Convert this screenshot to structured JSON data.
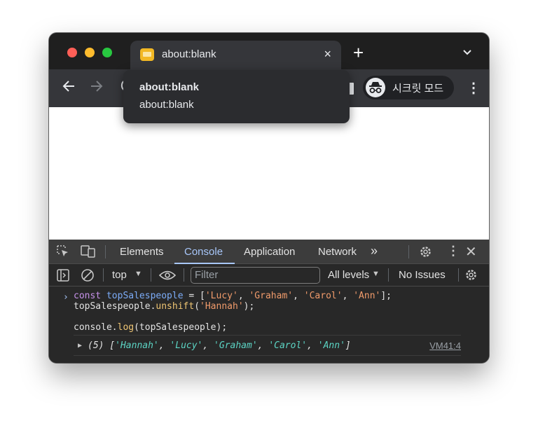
{
  "window": {
    "tab": {
      "title": "about:blank",
      "close": "×"
    },
    "new_tab": "+",
    "tab_search": "⌄",
    "incognito_label": "시크릿 모드",
    "menu": "⋮",
    "tooltip": {
      "title": "about:blank",
      "url": "about:blank"
    }
  },
  "devtools": {
    "tabs": [
      "Elements",
      "Console",
      "Application",
      "Network"
    ],
    "active_tab": "Console",
    "more_tabs": "»",
    "context": "top",
    "filter_placeholder": "Filter",
    "levels": "All levels",
    "issues": "No Issues",
    "console": {
      "prompt": "›",
      "input_lines": [
        "const topSalespeople = ['Lucy', 'Graham', 'Carol', 'Ann'];",
        "topSalespeople.unshift('Hannah');",
        "",
        "console.log(topSalespeople);"
      ],
      "output": "(5) ['Hannah', 'Lucy', 'Graham', 'Carol', 'Ann']",
      "output_items": [
        "'Hannah'",
        "'Lucy'",
        "'Graham'",
        "'Carol'",
        "'Ann'"
      ],
      "output_count": "(5)",
      "source_link": "VM41:4"
    }
  },
  "colors": {
    "accent": "#a8c7fa",
    "string": "#f09b6b",
    "output_string": "#5cd5c5"
  }
}
